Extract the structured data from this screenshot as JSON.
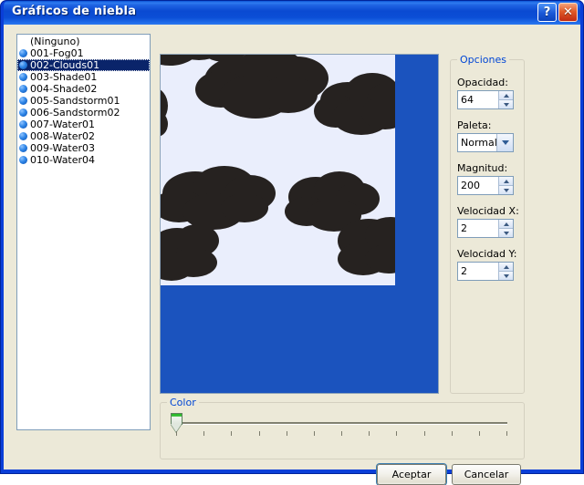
{
  "window": {
    "title": "Gráficos de niebla",
    "help_button_label": "?",
    "close_button_label": "✕",
    "accent_color": "#0a4ad2",
    "client_background": "#ece9d8"
  },
  "graphics_list": {
    "name": "fog-graphics-list",
    "selected_index": 2,
    "items": [
      {
        "label": "(Ninguno)",
        "has_bullet": false
      },
      {
        "label": "001-Fog01",
        "has_bullet": true
      },
      {
        "label": "002-Clouds01",
        "has_bullet": true
      },
      {
        "label": "003-Shade01",
        "has_bullet": true
      },
      {
        "label": "004-Shade02",
        "has_bullet": true
      },
      {
        "label": "005-Sandstorm01",
        "has_bullet": true
      },
      {
        "label": "006-Sandstorm02",
        "has_bullet": true
      },
      {
        "label": "007-Water01",
        "has_bullet": true
      },
      {
        "label": "008-Water02",
        "has_bullet": true
      },
      {
        "label": "009-Water03",
        "has_bullet": true
      },
      {
        "label": "010-Water04",
        "has_bullet": true
      }
    ]
  },
  "preview": {
    "name": "graphic-preview",
    "background_color": "#1b53be",
    "texture_background": "#eaeefc",
    "cloud_color": "#262220"
  },
  "options": {
    "legend": "Opciones",
    "legend_color": "#0046d5",
    "fields": [
      {
        "label": "Opacidad:",
        "value": "64",
        "type": "spinner"
      },
      {
        "label": "Paleta:",
        "value": "Normal",
        "type": "combo"
      },
      {
        "label": "Magnitud:",
        "value": "200",
        "type": "spinner"
      },
      {
        "label": "Velocidad X:",
        "value": "2",
        "type": "spinner"
      },
      {
        "label": "Velocidad Y:",
        "value": "2",
        "type": "spinner"
      }
    ]
  },
  "color_slider": {
    "legend": "Color",
    "legend_color": "#0046d5",
    "value": 0,
    "min": 0,
    "max": 12,
    "tick_count": 13,
    "thumb_color": "#2cba2c"
  },
  "footer": {
    "accept_label": "Aceptar",
    "cancel_label": "Cancelar"
  }
}
